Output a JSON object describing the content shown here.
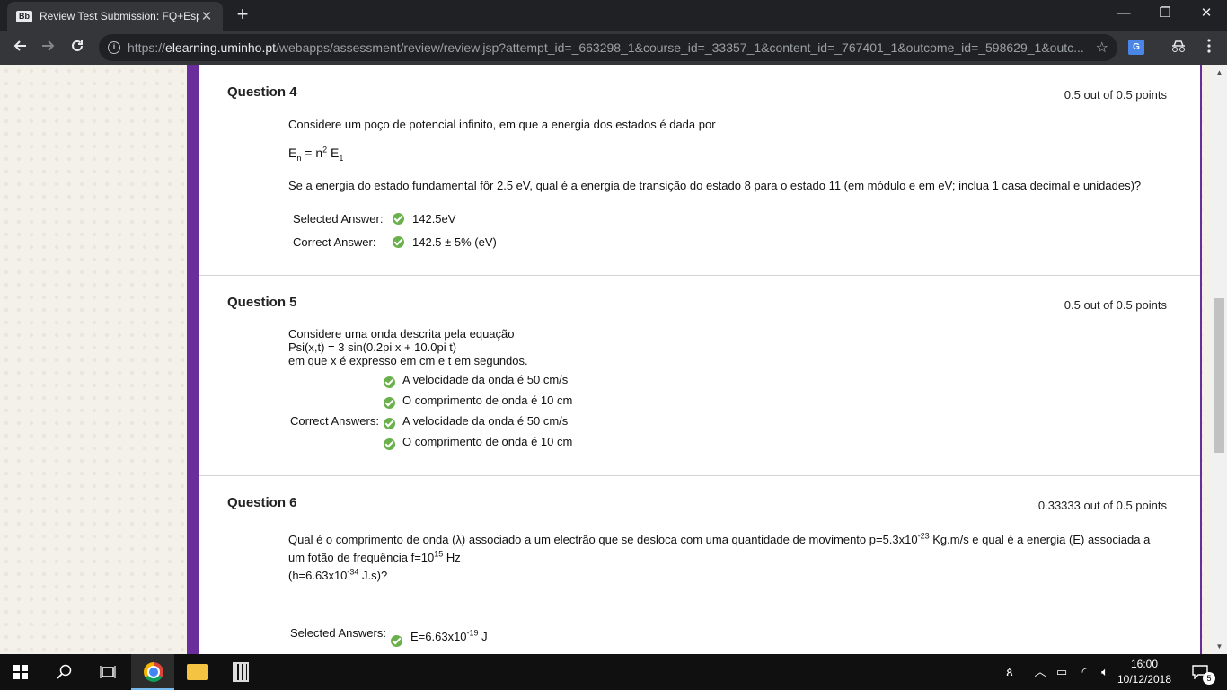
{
  "browser": {
    "tab_title": "Review Test Submission: FQ+Esp",
    "favicon_text": "Bb",
    "tab_close": "✕",
    "new_tab": "+",
    "url_scheme": "https://",
    "url_host": "elearning.uminho.pt",
    "url_path": "/webapps/assessment/review/review.jsp?attempt_id=_663298_1&course_id=_33357_1&content_id=_767401_1&outcome_id=_598629_1&outc...",
    "minimize": "—",
    "restore": "❐",
    "close": "✕"
  },
  "questions": [
    {
      "title": "Question 4",
      "points": "0.5 out of 0.5 points",
      "intro": "Considere um poço de potencial infinito, em que a energia dos estados é dada por",
      "formula_E": "E",
      "formula_n_sub": "n",
      "formula_mid": " = n",
      "formula_sup": "2",
      "formula_E1": " E",
      "formula_1_sub": "1",
      "prompt": "Se a energia do estado fundamental fôr 2.5 eV, qual é a energia de transição do estado 8 para o estado 11 (em módulo e em eV; inclua 1 casa decimal e unidades)?",
      "selected_label": "Selected Answer:",
      "selected_value": "142.5eV",
      "correct_label": "Correct Answer:",
      "correct_value": "142.5 ± 5% (eV)"
    },
    {
      "title": "Question 5",
      "points": "0.5 out of 0.5 points",
      "line1": "Considere uma onda descrita pela equação",
      "line2": "Psi(x,t) = 3 sin(0.2pi x + 10.0pi t)",
      "line3": "em que x é expresso em cm e t em segundos.",
      "answers": [
        "A velocidade da onda é 50 cm/s",
        "O comprimento de onda é 10 cm",
        "A velocidade da onda é 50 cm/s",
        "O comprimento de onda é 10 cm"
      ],
      "correct_label": "Correct Answers:"
    },
    {
      "title": "Question 6",
      "points": "0.33333 out of 0.5 points",
      "p1a": "Qual é o comprimento de onda (λ) associado a um electrão que se desloca com uma quantidade de movimento p=5.3x10",
      "p1sup": "-23",
      "p1b": " Kg.m/s e qual é a energia (E) associada a",
      "p2a": "um fotão de frequência f=10",
      "p2sup": "15",
      "p2b": " Hz",
      "p3a": "(h=6.63x10",
      "p3sup": "-34",
      "p3b": " J.s)?",
      "selected_label": "Selected Answers:",
      "sel1a": "E=6.63x10",
      "sel1sup": "-19",
      "sel1b": " J"
    }
  ],
  "taskbar": {
    "time": "16:00",
    "date": "10/12/2018",
    "notif_count": "5"
  }
}
